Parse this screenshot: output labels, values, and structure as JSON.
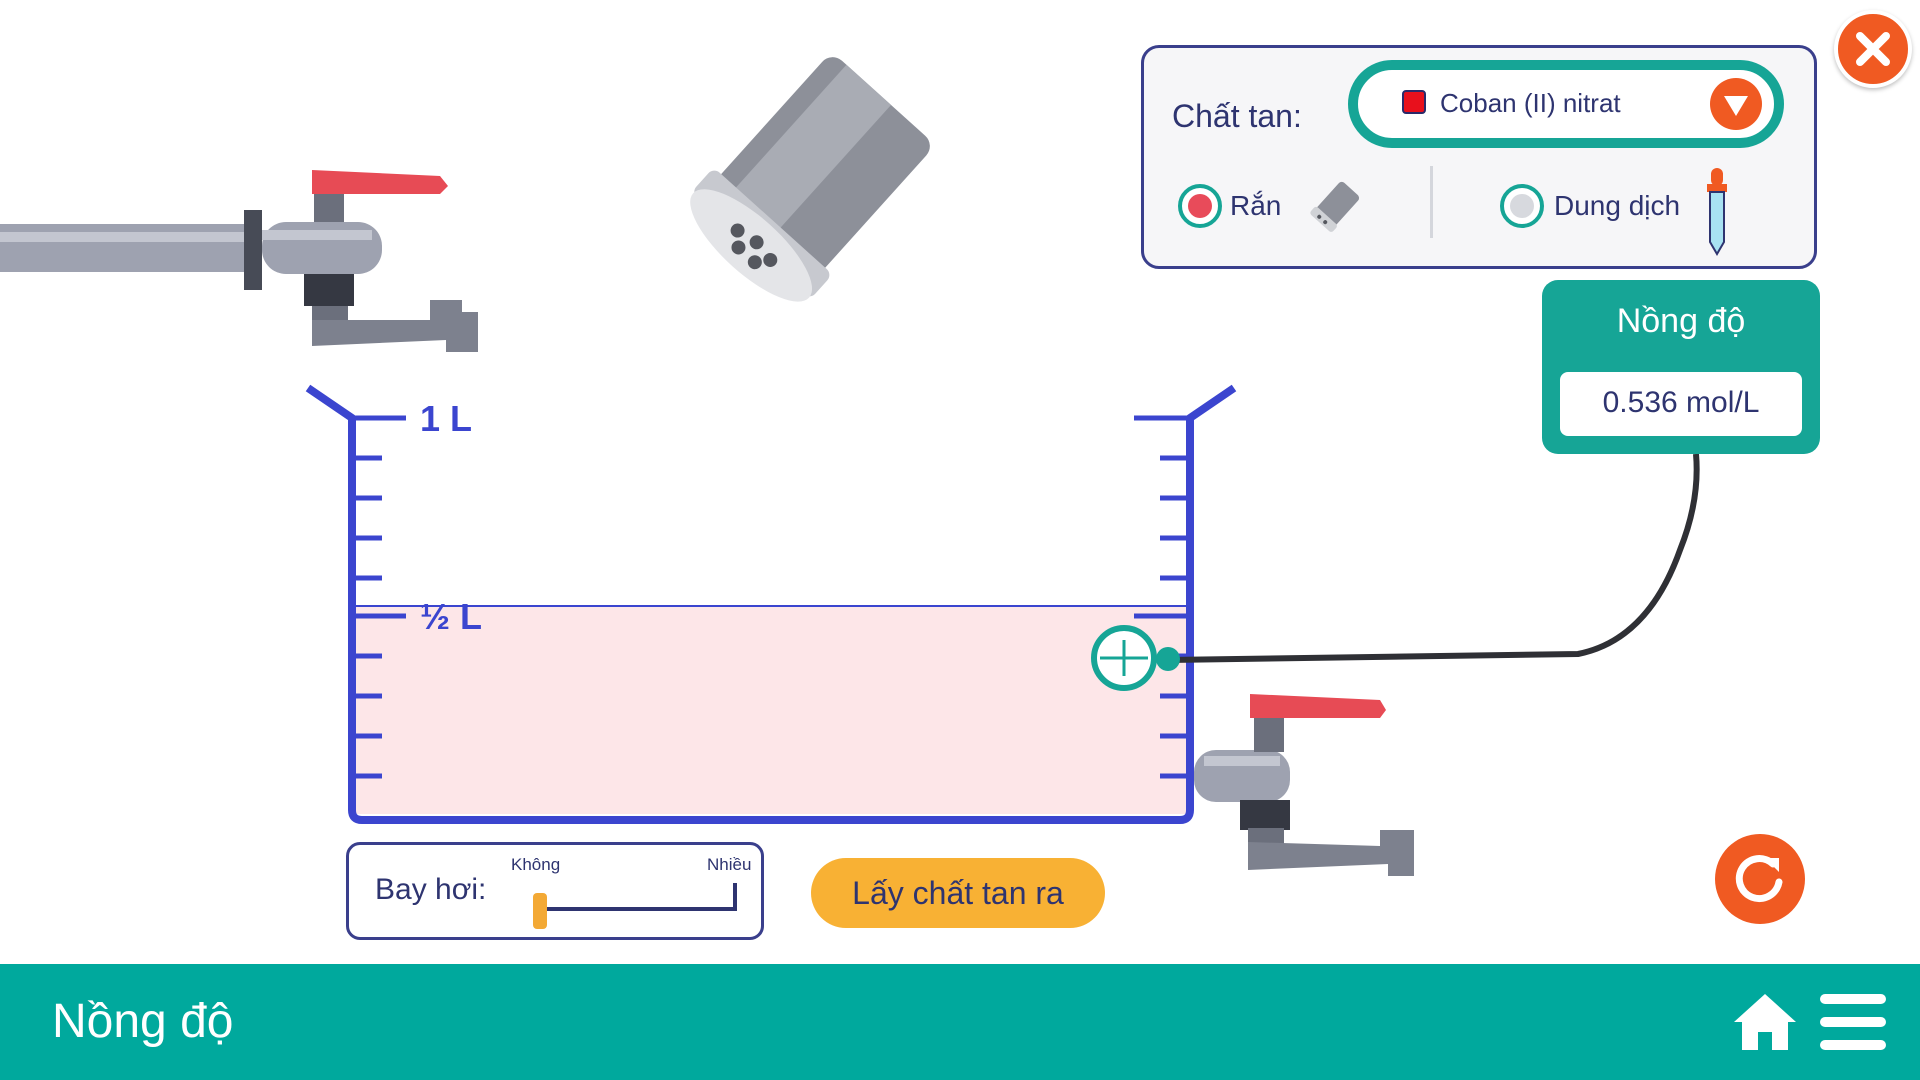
{
  "solute_panel": {
    "label": "Chất tan:",
    "selected_solute": "Coban (II) nitrat",
    "selected_color": "#e8101c",
    "form_options": [
      {
        "label": "Rắn",
        "selected": true
      },
      {
        "label": "Dung dịch",
        "selected": false
      }
    ]
  },
  "beaker": {
    "mark_full": "1 L",
    "mark_half": "½ L",
    "solution_color": "#fde6e8"
  },
  "meter": {
    "title": "Nồng độ",
    "value": "0.536 mol/L"
  },
  "evaporation": {
    "label": "Bay hơi:",
    "min_label": "Không",
    "max_label": "Nhiều",
    "level": 0
  },
  "buttons": {
    "remove_solute": "Lấy chất tan ra"
  },
  "bottom_bar": {
    "title": "Nồng độ"
  },
  "icons": {
    "close": "close-icon",
    "dropdown": "chevron-down-icon",
    "reset": "reset-icon",
    "home": "home-icon",
    "menu": "menu-icon"
  },
  "colors": {
    "teal": "#16a596",
    "navy": "#2e3470",
    "orange": "#f05a22",
    "yellow": "#f8b134",
    "beaker": "#3b45cf"
  }
}
